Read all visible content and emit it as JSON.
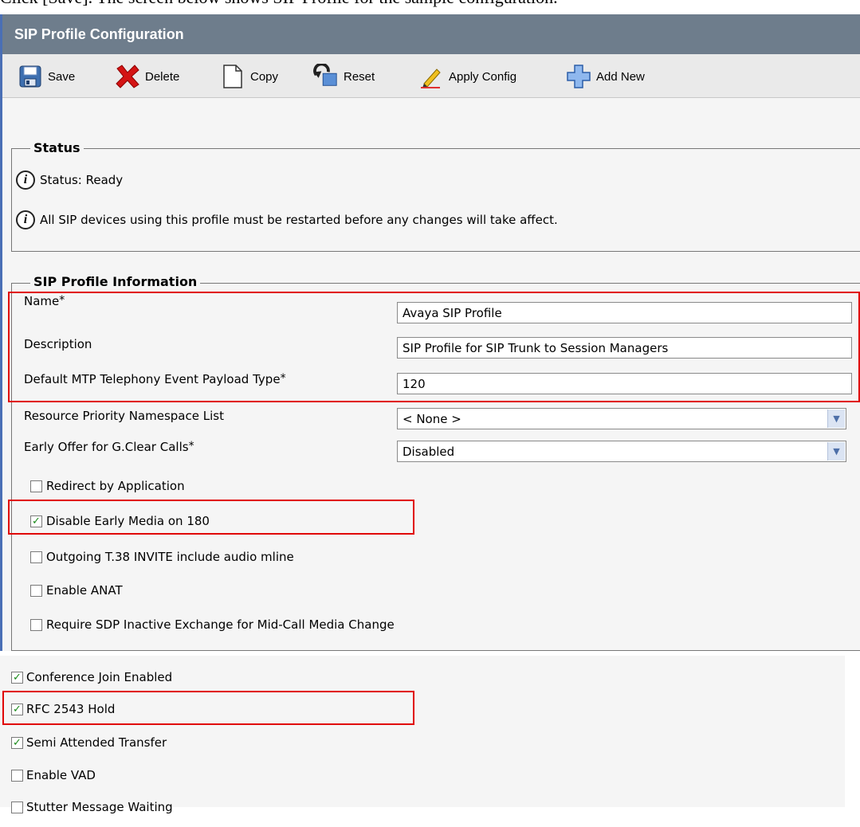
{
  "doc": {
    "text": "Click [Save]. The screen below shows SIP Profile for the sample configuration."
  },
  "window": {
    "title": "SIP Profile Configuration"
  },
  "toolbar": {
    "save_label": "Save",
    "delete_label": "Delete",
    "copy_label": "Copy",
    "reset_label": "Reset",
    "apply_config_label": "Apply Config",
    "add_new_label": "Add New"
  },
  "status": {
    "legend": "Status",
    "line1": "Status: Ready",
    "line2": "All SIP devices using this profile must be restarted before any changes will take affect."
  },
  "info": {
    "legend": "SIP Profile Information",
    "name_label": "Name",
    "name_value": "Avaya SIP Profile",
    "description_label": "Description",
    "description_value": "SIP Profile for SIP Trunk to Session Managers",
    "payload_label": "Default MTP Telephony Event Payload Type",
    "payload_value": "120",
    "namespace_label": "Resource Priority Namespace List",
    "namespace_value": "< None >",
    "early_offer_label": "Early Offer for G.Clear Calls",
    "early_offer_value": "Disabled",
    "required_marker": "*"
  },
  "checkboxes": [
    {
      "label": "Redirect by Application",
      "checked": false
    },
    {
      "label": "Disable Early Media on 180",
      "checked": true
    },
    {
      "label": "Outgoing T.38 INVITE include audio mline",
      "checked": false
    },
    {
      "label": "Enable ANAT",
      "checked": false
    },
    {
      "label": "Require SDP Inactive Exchange for Mid-Call Media Change",
      "checked": false
    },
    {
      "label": "Conference Join Enabled",
      "checked": true
    },
    {
      "label": "RFC 2543 Hold",
      "checked": true
    },
    {
      "label": "Semi Attended Transfer",
      "checked": true
    },
    {
      "label": "Enable VAD",
      "checked": false
    },
    {
      "label": "Stutter Message Waiting",
      "checked": false
    }
  ],
  "colors": {
    "titlebar": "#6e7d8c",
    "highlight": "#e00000",
    "check": "#1a8a1a"
  }
}
